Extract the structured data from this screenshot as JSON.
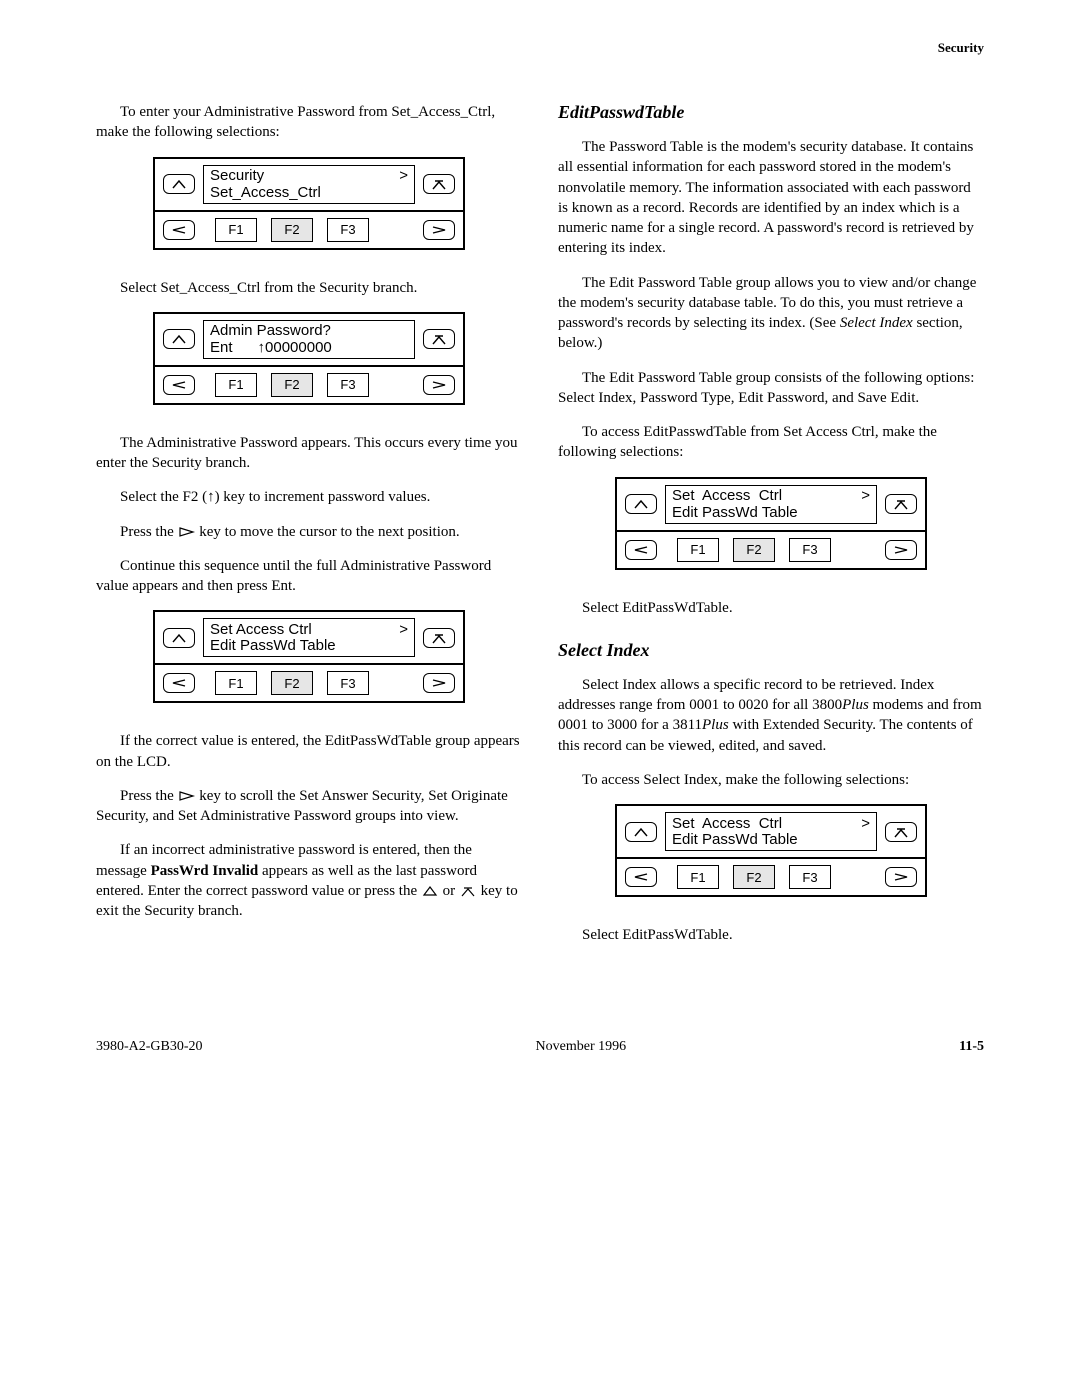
{
  "header": {
    "section": "Security"
  },
  "left": {
    "p1": "To enter your Administrative Password from Set_Access_Ctrl, make the following selections:",
    "p2": "Select Set_Access_Ctrl from the Security branch.",
    "p3": "The Administrative Password appears. This occurs every time you enter the Security branch.",
    "p4": "Select the F2 (↑) key to increment password values.",
    "p5a": "Press the  ",
    "p5b": "  key to move the cursor to the next position.",
    "p6": "Continue this sequence until the full Administrative Password value appears and then press Ent.",
    "p7": "If the correct value is entered, the EditPassWdTable group appears on the LCD.",
    "p8a": "Press the  ",
    "p8b": "  key to scroll the Set Answer Security, Set Originate Security, and Set Administrative Password groups into view.",
    "p9a": "If an incorrect administrative password is entered, then the message ",
    "p9b": "PassWrd Invalid",
    "p9c": " appears as well as the last password entered. Enter the correct password value or press the  ",
    "p9d": "  or  ",
    "p9e": "  key to exit the Security branch."
  },
  "right": {
    "h1": "EditPasswdTable",
    "p1": "The Password Table is the modem's security database. It contains all essential information for each password stored in the modem's nonvolatile memory. The information associated with each password is known as a record. Records are identified by an index which is a numeric name for a single record. A password's record is retrieved by entering its index.",
    "p2a": "The Edit Password Table group allows you to view and/or change the modem's security database table. To do this, you must retrieve a password's records by selecting its index. (See ",
    "p2b": "Select Index",
    "p2c": " section, below.)",
    "p3": "The Edit Password Table group consists of the following options: Select Index, Password Type, Edit Password, and Save Edit.",
    "p4": "To access EditPasswdTable from Set Access Ctrl, make the following selections:",
    "p5": "Select EditPassWdTable.",
    "h2": "Select Index",
    "p6a": "Select Index allows a specific record to be retrieved. Index addresses range from 0001 to 0020 for all 3800",
    "p6b": "Plus",
    "p6c": " modems and from 0001 to 3000 for a 3811",
    "p6d": "Plus",
    "p6e": " with Extended Security. The contents of this record can be viewed, edited, and saved.",
    "p7": "To access Select Index, make the following selections:",
    "p8": "Select EditPassWdTable."
  },
  "lcd": {
    "p1_line1_left": "Security",
    "p1_line1_right": ">",
    "p1_line2": "Set_Access_Ctrl",
    "p2_line1": "Admin Password?",
    "p2_line2": "Ent      ↑00000000",
    "p3_line1_left": "Set Access Ctrl",
    "p3_line1_right": ">",
    "p3_line2": "Edit PassWd Table",
    "pR_line1_left": "Set  Access  Ctrl",
    "pR_line1_right": ">",
    "pR_line2": "Edit PassWd Table",
    "f1": "F1",
    "f2": "F2",
    "f3": "F3"
  },
  "footer": {
    "left": "3980-A2-GB30-20",
    "center": "November 1996",
    "right": "11-5"
  }
}
